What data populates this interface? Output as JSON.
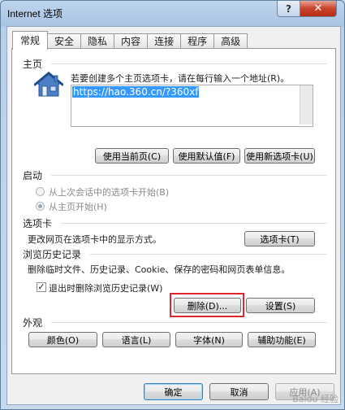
{
  "window": {
    "title": "Internet 选项",
    "help_label": "?",
    "close_label": "✕"
  },
  "tabs": [
    {
      "label": "常规",
      "active": true
    },
    {
      "label": "安全"
    },
    {
      "label": "隐私"
    },
    {
      "label": "内容"
    },
    {
      "label": "连接"
    },
    {
      "label": "程序"
    },
    {
      "label": "高级"
    }
  ],
  "homepage": {
    "title": "主页",
    "description": "若要创建多个主页选项卡，请在每行输入一个地址(R)。",
    "value": "https://hao.360.cn/?360xf",
    "use_current": "使用当前页(C)",
    "use_default": "使用默认值(F)",
    "use_new_tab": "使用新选项卡(U)"
  },
  "startup": {
    "title": "启动",
    "option_last_session": "从上次会话中的选项卡开始(B)",
    "option_home": "从主页开始(H)"
  },
  "tabs_section": {
    "title": "选项卡",
    "description": "更改网页在选项卡中的显示方式。",
    "button": "选项卡(T)"
  },
  "history": {
    "title": "浏览历史记录",
    "description": "删除临时文件、历史记录、Cookie、保存的密码和网页表单信息。",
    "checkbox_label": "退出时删除浏览历史记录(W)",
    "checkbox_checked": true,
    "delete_button": "删除(D)...",
    "settings_button": "设置(S)"
  },
  "appearance": {
    "title": "外观",
    "colors": "颜色(O)",
    "languages": "语言(L)",
    "fonts": "字体(N)",
    "accessibility": "辅助功能(E)"
  },
  "footer": {
    "ok": "确定",
    "cancel": "取消",
    "apply": "应用(A)"
  },
  "watermark": "Baidu 经验"
}
